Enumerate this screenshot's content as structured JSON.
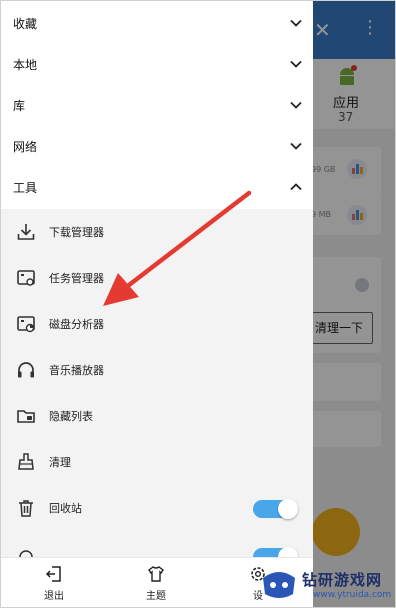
{
  "background": {
    "app_label": "应用",
    "app_count": "37",
    "storage_1": "99 GB",
    "storage_2": "9 MB",
    "clean_button": "清理一下"
  },
  "drawer": {
    "sections": [
      {
        "label": "收藏",
        "expanded": false
      },
      {
        "label": "本地",
        "expanded": false
      },
      {
        "label": "库",
        "expanded": false
      },
      {
        "label": "网络",
        "expanded": false
      },
      {
        "label": "工具",
        "expanded": true
      }
    ],
    "tools": [
      {
        "label": "下载管理器",
        "icon": "download-icon"
      },
      {
        "label": "任务管理器",
        "icon": "task-manager-icon"
      },
      {
        "label": "磁盘分析器",
        "icon": "disk-analyzer-icon"
      },
      {
        "label": "音乐播放器",
        "icon": "headphones-icon"
      },
      {
        "label": "隐藏列表",
        "icon": "hidden-folder-icon"
      },
      {
        "label": "清理",
        "icon": "broom-icon"
      },
      {
        "label": "回收站",
        "icon": "trash-icon",
        "toggle": true
      },
      {
        "label": "",
        "icon": "partial-icon",
        "toggle": true
      }
    ],
    "bottom": [
      {
        "label": "退出",
        "icon": "exit-icon"
      },
      {
        "label": "主题",
        "icon": "shirt-icon"
      },
      {
        "label": "设",
        "icon": "settings-icon"
      }
    ]
  },
  "watermark": {
    "text": "钻研游戏网",
    "url": "www.ytruida.com"
  },
  "colors": {
    "accent": "#4aa6ea",
    "arrow": "#e53a32",
    "fab": "#f2b01e"
  }
}
